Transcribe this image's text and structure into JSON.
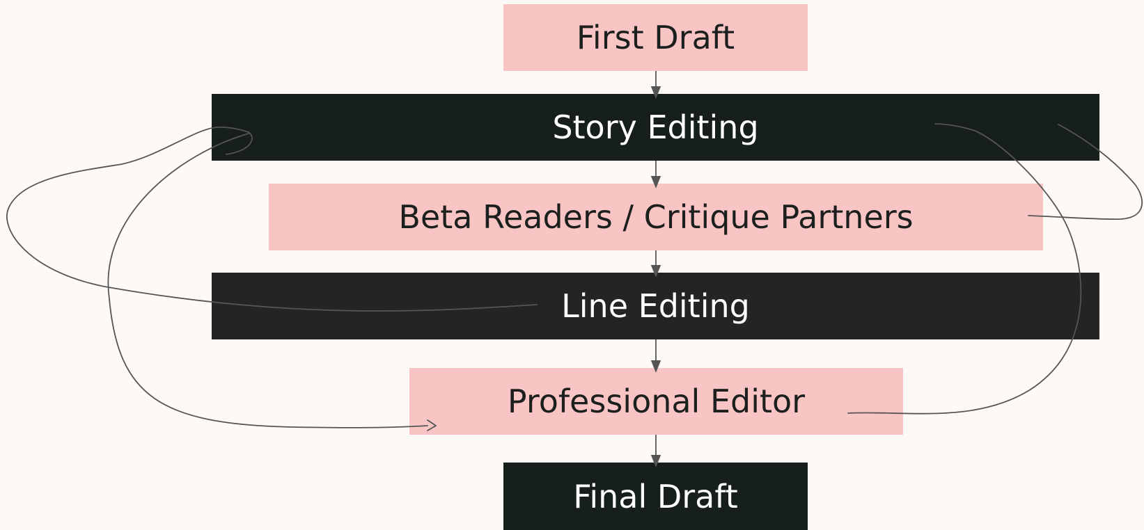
{
  "diagram": {
    "nodes": [
      {
        "id": "first-draft",
        "label": "First Draft"
      },
      {
        "id": "story-editing",
        "label": "Story Editing"
      },
      {
        "id": "beta-readers",
        "label": "Beta Readers / Critique Partners"
      },
      {
        "id": "line-editing",
        "label": "Line Editing"
      },
      {
        "id": "professional-editor",
        "label": "Professional Editor"
      },
      {
        "id": "final-draft",
        "label": "Final Draft"
      }
    ],
    "edges": [
      {
        "from": "first-draft",
        "to": "story-editing"
      },
      {
        "from": "story-editing",
        "to": "beta-readers"
      },
      {
        "from": "beta-readers",
        "to": "line-editing"
      },
      {
        "from": "line-editing",
        "to": "professional-editor"
      },
      {
        "from": "professional-editor",
        "to": "final-draft"
      }
    ],
    "colors": {
      "background": "#fdf9f6",
      "pink": "#f8c4c4",
      "dark": "#171f1a",
      "dark_alt": "#242424",
      "connector": "#555555"
    }
  }
}
